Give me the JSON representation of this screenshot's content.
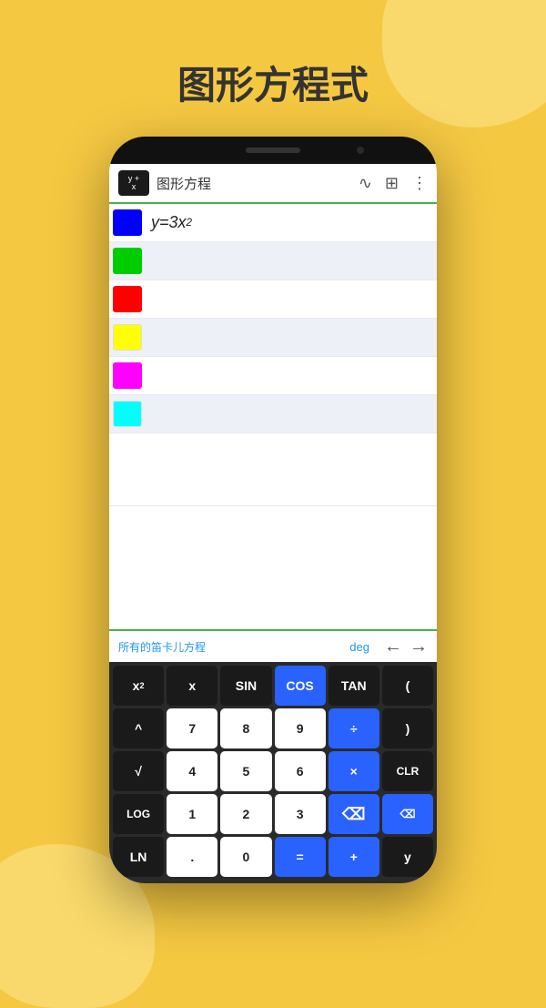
{
  "page": {
    "title": "图形方程式",
    "background_color": "#f5c842"
  },
  "app": {
    "toolbar": {
      "logo_line1": "y +",
      "logo_line2": "x",
      "title": "图形方程",
      "wave_icon": "∿",
      "grid_icon": "⊞",
      "more_icon": "⋮"
    },
    "equations": [
      {
        "color": "#0000FF",
        "text": "y=3x",
        "superscript": "2",
        "bg": "white"
      },
      {
        "color": "#00CC00",
        "text": "",
        "superscript": "",
        "bg": "blue-tint"
      },
      {
        "color": "#FF0000",
        "text": "",
        "superscript": "",
        "bg": "white"
      },
      {
        "color": "#FFFF00",
        "text": "",
        "superscript": "",
        "bg": "blue-tint"
      },
      {
        "color": "#FF00FF",
        "text": "",
        "superscript": "",
        "bg": "white"
      },
      {
        "color": "#00FFFF",
        "text": "",
        "superscript": "",
        "bg": "blue-tint"
      }
    ],
    "bottom_bar": {
      "label": "所有的笛卡儿方程",
      "deg": "deg",
      "arrow_left": "←",
      "arrow_right": "→"
    },
    "keyboard": {
      "rows": [
        [
          {
            "label": "x²",
            "style": "dark",
            "superscript": true
          },
          {
            "label": "x",
            "style": "dark"
          },
          {
            "label": "SIN",
            "style": "dark"
          },
          {
            "label": "COS",
            "style": "blue"
          },
          {
            "label": "TAN",
            "style": "dark"
          },
          {
            "label": "(",
            "style": "dark"
          }
        ],
        [
          {
            "label": "^",
            "style": "dark"
          },
          {
            "label": "7",
            "style": "white"
          },
          {
            "label": "8",
            "style": "white"
          },
          {
            "label": "9",
            "style": "white"
          },
          {
            "label": "÷",
            "style": "blue"
          },
          {
            "label": ")",
            "style": "dark"
          }
        ],
        [
          {
            "label": "√",
            "style": "dark"
          },
          {
            "label": "4",
            "style": "white"
          },
          {
            "label": "5",
            "style": "white"
          },
          {
            "label": "6",
            "style": "white"
          },
          {
            "label": "×",
            "style": "blue"
          },
          {
            "label": "CLR",
            "style": "dark",
            "sm": true
          }
        ],
        [
          {
            "label": "LOG",
            "style": "dark",
            "sm": true
          },
          {
            "label": "1",
            "style": "white"
          },
          {
            "label": "2",
            "style": "white"
          },
          {
            "label": "3",
            "style": "white"
          },
          {
            "label": "⌫",
            "style": "blue",
            "sm": true
          },
          {
            "label": "",
            "style": "blue",
            "backspace": true
          }
        ],
        [
          {
            "label": "LN",
            "style": "dark"
          },
          {
            "label": ".",
            "style": "white"
          },
          {
            "label": "0",
            "style": "white"
          },
          {
            "label": "=",
            "style": "blue"
          },
          {
            "label": "+",
            "style": "blue"
          },
          {
            "label": "y",
            "style": "dark"
          }
        ]
      ]
    }
  }
}
